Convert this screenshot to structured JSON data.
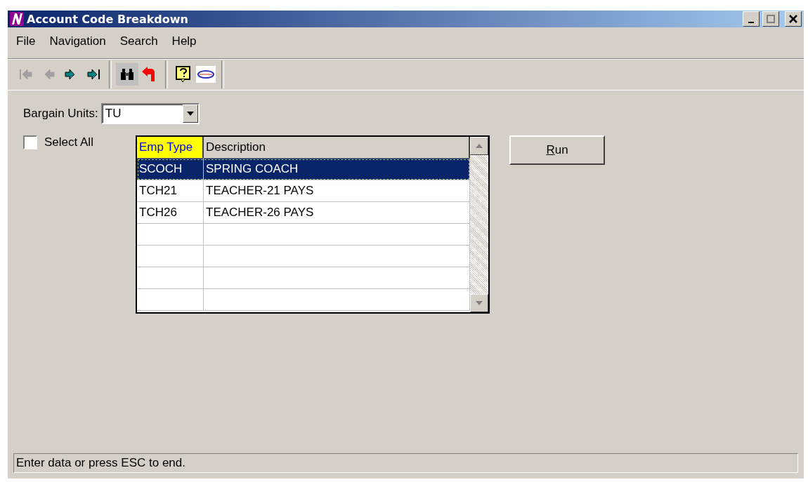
{
  "window": {
    "title": "Account Code Breakdown"
  },
  "menu": [
    "File",
    "Navigation",
    "Search",
    "Help"
  ],
  "toolbar": [
    {
      "kind": "first",
      "disabled": true
    },
    {
      "kind": "prev",
      "disabled": true
    },
    {
      "kind": "next",
      "disabled": false
    },
    {
      "kind": "last",
      "disabled": false
    },
    {
      "kind": "sep"
    },
    {
      "kind": "find",
      "selected": true
    },
    {
      "kind": "undo",
      "selected": false
    },
    {
      "kind": "sep"
    },
    {
      "kind": "help"
    },
    {
      "kind": "logo"
    }
  ],
  "bargain_units": {
    "label": "Bargain Units:",
    "value": "TU"
  },
  "select_all": {
    "label": "Select All",
    "checked": false
  },
  "table": {
    "columns": [
      "Emp Type",
      "Description"
    ],
    "rows": [
      {
        "cells": [
          "SCOCH",
          "SPRING COACH"
        ],
        "selected": true
      },
      {
        "cells": [
          "TCH21",
          "TEACHER-21 PAYS"
        ],
        "selected": false
      },
      {
        "cells": [
          "TCH26",
          "TEACHER-26 PAYS"
        ],
        "selected": false
      }
    ]
  },
  "run_button": "Run",
  "status_bar": "Enter data or press ESC to end."
}
